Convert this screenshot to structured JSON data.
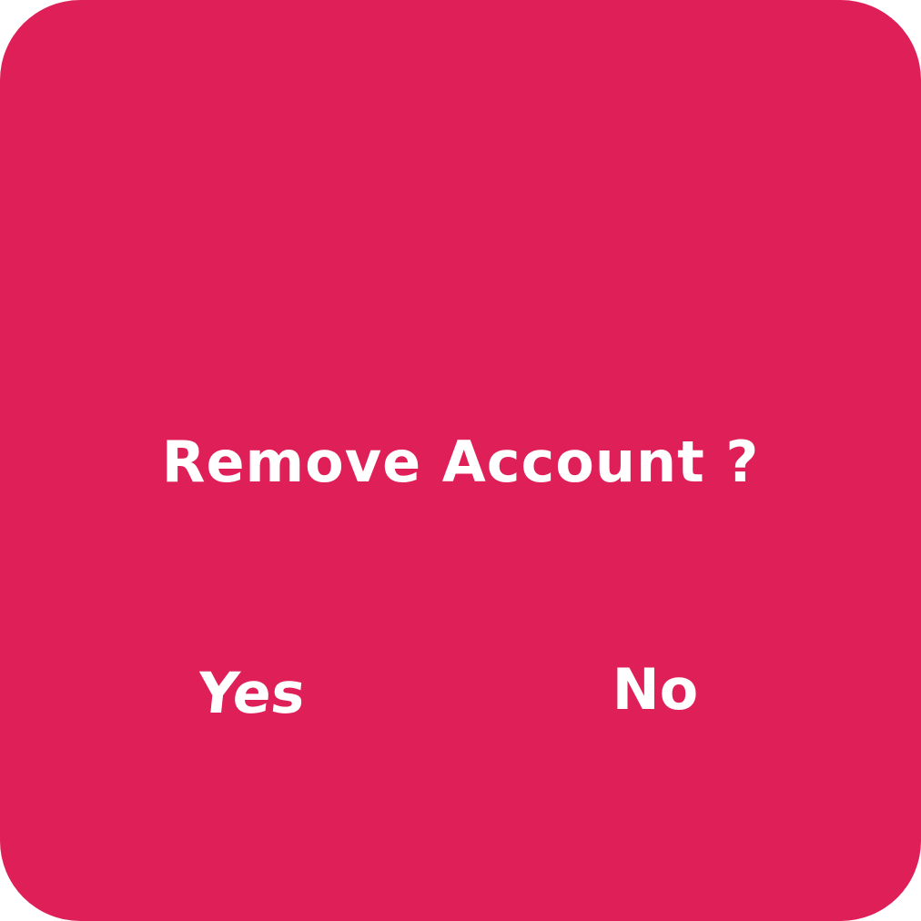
{
  "dialog": {
    "title": "Remove Account ?",
    "yes_label": "Yes",
    "no_label": "No"
  },
  "colors": {
    "background": "#df2058",
    "text": "#ffffff"
  }
}
